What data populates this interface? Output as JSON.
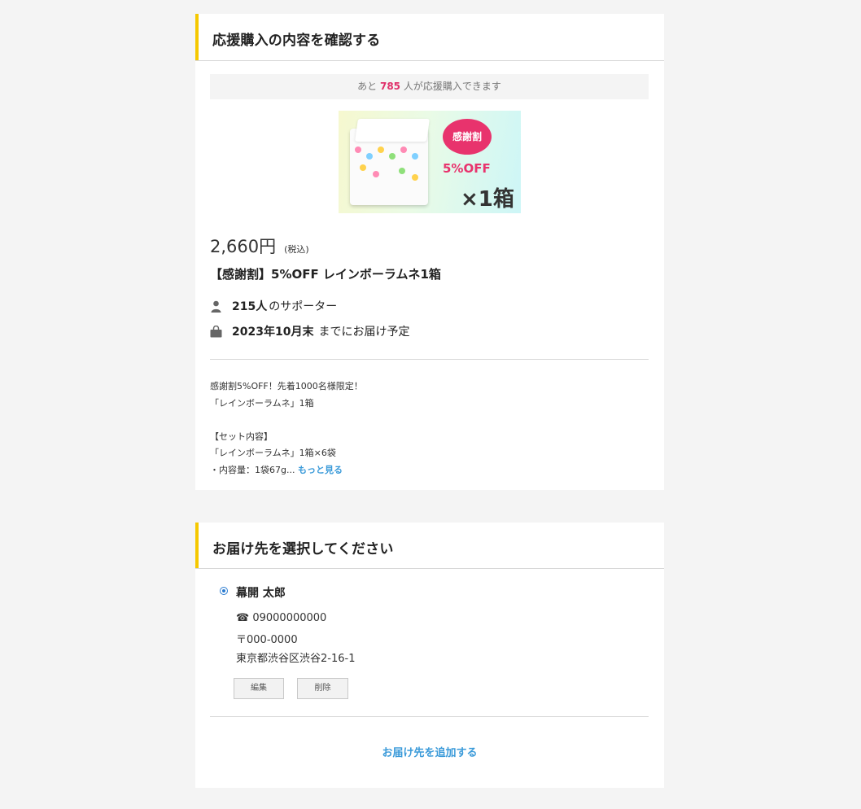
{
  "confirm": {
    "heading": "応援購入の内容を確認する",
    "remaining_pre": "あと",
    "remaining_count": "785",
    "remaining_post": "人が応援購入できます",
    "thumbnail": {
      "badge": "感謝割",
      "discount": "5%OFF",
      "quantity": "×1箱"
    },
    "price": "2,660円",
    "tax_note": "(税込)",
    "product_title": "【感謝割】5%OFF レインボーラムネ1箱",
    "supporters_count": "215人",
    "supporters_label": "のサポーター",
    "delivery_date": "2023年10月末",
    "delivery_label": "までにお届け予定",
    "description": [
      "感謝割5%OFF！先着1000名様限定！",
      "「レインボーラムネ」1箱",
      "",
      "【セット内容】",
      "「レインボーラムネ」1箱×6袋",
      "・内容量：1袋67g..."
    ],
    "more_link": "もっと見る",
    "colors": {
      "accent": "#f5c800",
      "count": "#e0306a",
      "link": "#3a9ad9"
    }
  },
  "delivery": {
    "heading": "お届け先を選択してください",
    "name": "幕開 太郎",
    "phone_icon": "☎",
    "phone": "09000000000",
    "postal": "〒000-0000",
    "address": "東京都渋谷区渋谷2-16-1",
    "edit_label": "編集",
    "delete_label": "削除",
    "add_link": "お届け先を追加する"
  }
}
